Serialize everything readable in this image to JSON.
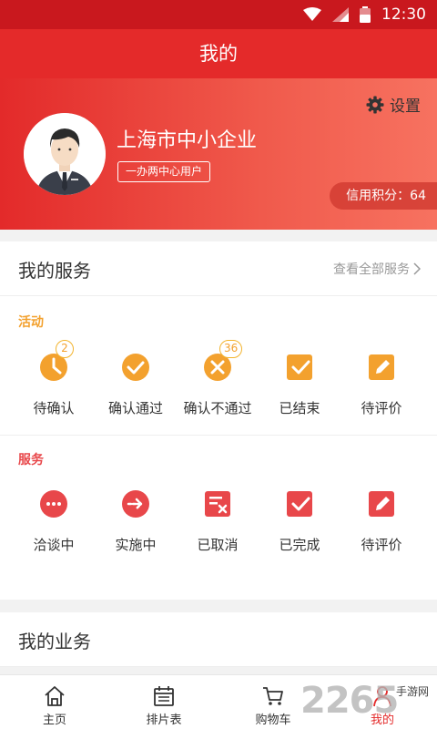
{
  "status_bar": {
    "time": "12:30"
  },
  "title": "我的",
  "profile": {
    "settings_label": "设置",
    "company_name": "上海市中小企业",
    "user_tag": "一办两中心用户",
    "credit": "信用积分：64"
  },
  "services": {
    "title": "我的服务",
    "view_all": "查看全部服务",
    "activity_label": "活动",
    "activity_items": [
      {
        "label": "待确认",
        "icon": "clock-icon",
        "badge": "2"
      },
      {
        "label": "确认通过",
        "icon": "check-circle-icon"
      },
      {
        "label": "确认不通过",
        "icon": "x-circle-icon",
        "badge": "36"
      },
      {
        "label": "已结束",
        "icon": "checked-box-icon"
      },
      {
        "label": "待评价",
        "icon": "edit-icon"
      }
    ],
    "service_label": "服务",
    "service_items": [
      {
        "label": "洽谈中",
        "icon": "chat-icon"
      },
      {
        "label": "实施中",
        "icon": "arrow-right-circle-icon"
      },
      {
        "label": "已取消",
        "icon": "cancelled-doc-icon"
      },
      {
        "label": "已完成",
        "icon": "checked-box-icon"
      },
      {
        "label": "待评价",
        "icon": "edit-icon"
      }
    ]
  },
  "business": {
    "title": "我的业务"
  },
  "tabs": [
    {
      "label": "主页",
      "icon": "home-icon"
    },
    {
      "label": "排片表",
      "icon": "calendar-icon"
    },
    {
      "label": "购物车",
      "icon": "cart-icon"
    },
    {
      "label": "我的",
      "icon": "person-icon",
      "active": true
    }
  ],
  "watermark": {
    "number": "2265",
    "text": "手游网"
  },
  "colors": {
    "primary_red": "#e42a2a",
    "status_red": "#c9181e",
    "activity_orange": "#f3a12e",
    "service_red": "#e8474a"
  }
}
